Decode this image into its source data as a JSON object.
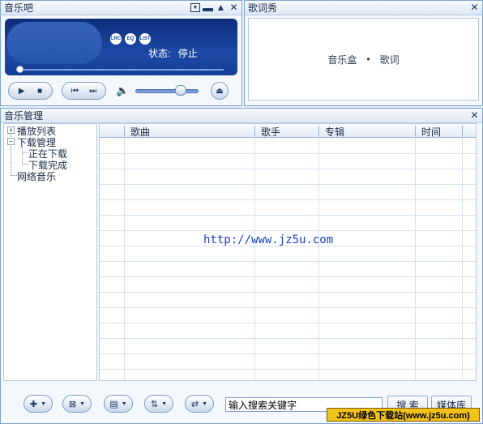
{
  "player": {
    "title": "音乐吧",
    "screen_icons": [
      "LRC",
      "EQ",
      "LIST"
    ],
    "status_label": "状态:",
    "status_value": "停止"
  },
  "lyrics": {
    "title": "歌词秀",
    "text_left": "音乐盒",
    "separator": "•",
    "text_right": "歌词"
  },
  "manager": {
    "title": "音乐管理",
    "tree": [
      "播放列表",
      "下载管理",
      "正在下载",
      "下载完成",
      "网络音乐"
    ],
    "columns": [
      "歌曲",
      "歌手",
      "专辑",
      "时间"
    ],
    "url": "http://www.jz5u.com"
  },
  "bottom": {
    "search_placeholder": "输入搜索关键字",
    "search_button": "搜 索",
    "media_button": "媒体库",
    "watermark": "JZ5U绿色下载站(www.jz5u.com)"
  }
}
